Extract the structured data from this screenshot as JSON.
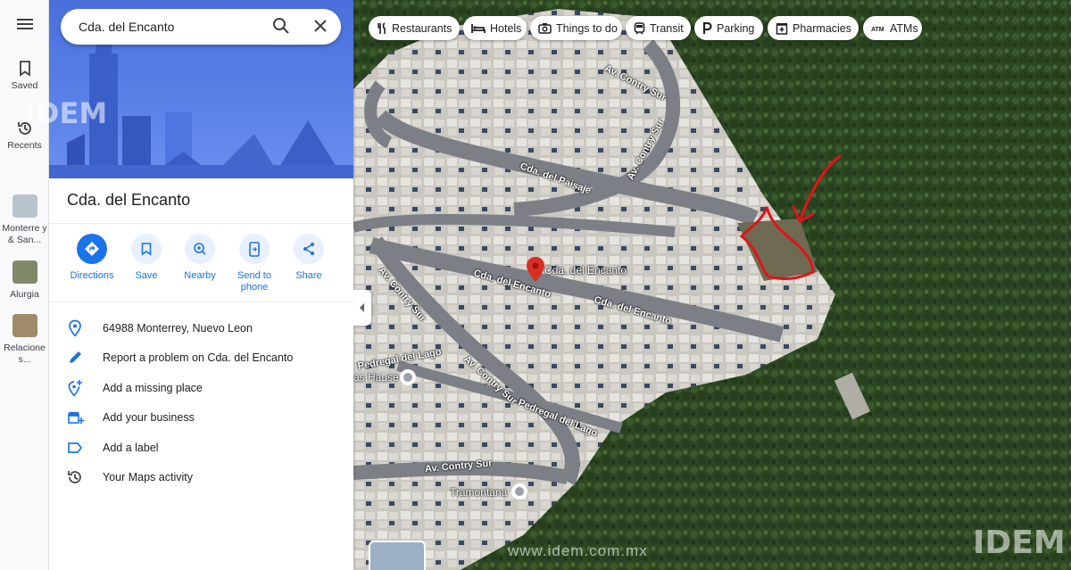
{
  "rail": {
    "saved": "Saved",
    "recents": "Recents",
    "items": [
      {
        "label": "Monterre y & San..."
      },
      {
        "label": "Alurgia"
      },
      {
        "label": "Relacione s..."
      }
    ]
  },
  "search": {
    "value": "Cda. del Encanto"
  },
  "place": {
    "title": "Cda. del Encanto"
  },
  "actions": {
    "directions": "Directions",
    "save": "Save",
    "nearby": "Nearby",
    "send_to_phone": "Send to phone",
    "share": "Share"
  },
  "info": {
    "address": "64988 Monterrey, Nuevo Leon",
    "report": "Report a problem on Cda. del Encanto",
    "add_place": "Add a missing place",
    "add_business": "Add your business",
    "add_label": "Add a label",
    "activity": "Your Maps activity"
  },
  "chips": {
    "restaurants": "Restaurants",
    "hotels": "Hotels",
    "things": "Things to do",
    "transit": "Transit",
    "parking": "Parking",
    "pharmacies": "Pharmacies",
    "atms": "ATMs"
  },
  "map": {
    "pin_label": "Cda. del Encanto",
    "tramontana": "Tramontana",
    "casa_hause": "as Hause",
    "streets": {
      "contry_sur_top": "Av. Contry Sur",
      "contry_sur_top2": "Av. Contry Sur",
      "paisaje": "Cda. del Paisaje",
      "encanto_1": "Cda. del Encanto",
      "encanto_2": "Cda. del Encanto",
      "contry_sur_mid": "Av. Contry Sur",
      "contry_sur_low": "Av. Contry Sur",
      "contry_sur_bottom": "Av. Contry Sur",
      "pedregal_1": "Pedregal del Lago",
      "pedregal_2": "Pedregal del Lago"
    }
  },
  "watermark": {
    "brand": "IDEM",
    "url": "www.idem.com.mx"
  },
  "colors": {
    "accent": "#1a73e8",
    "marker": "#d93025",
    "annotation": "#e0141a"
  }
}
